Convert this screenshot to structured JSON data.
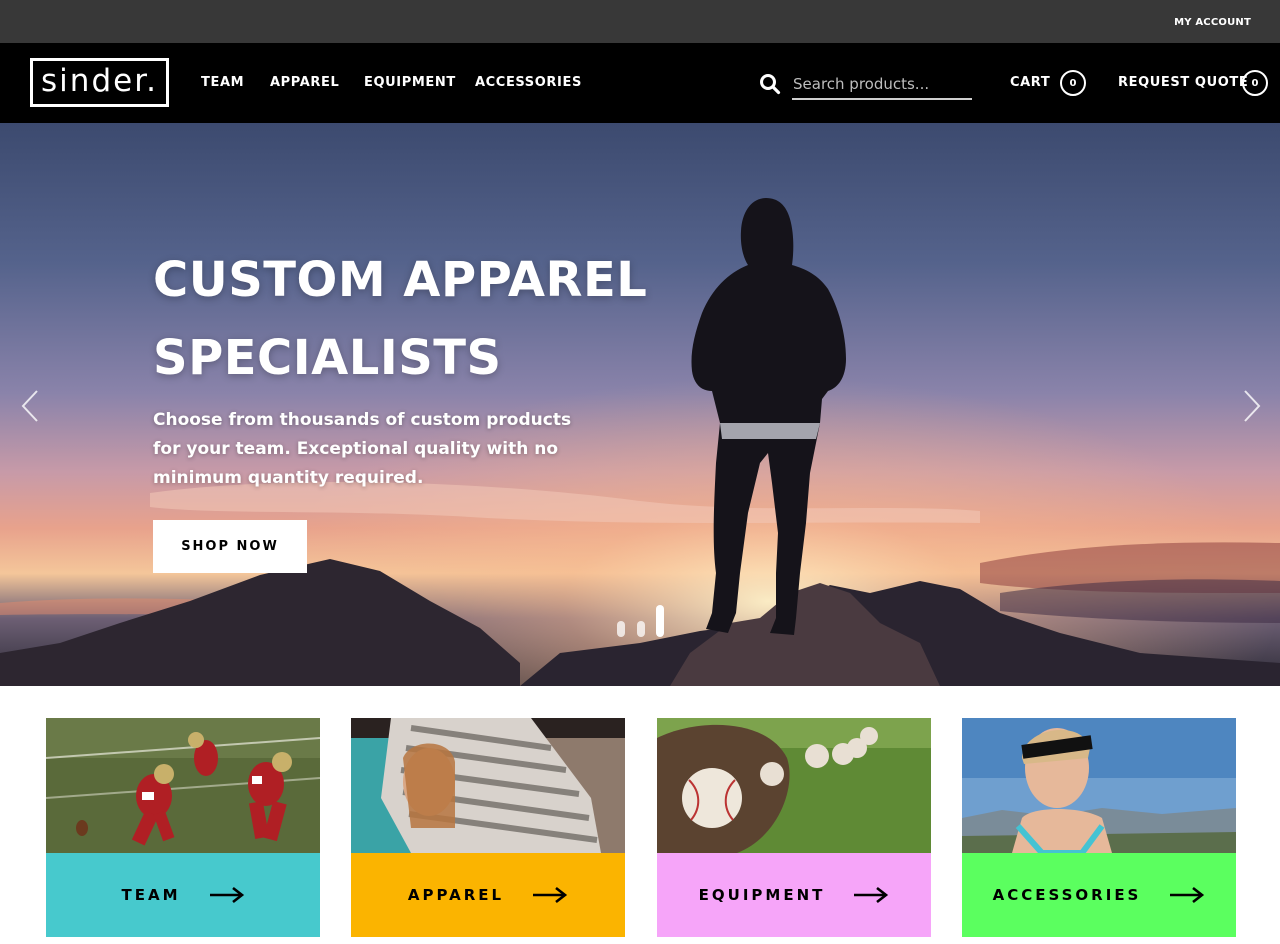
{
  "utility_bar": {
    "my_account": "MY ACCOUNT"
  },
  "header": {
    "logo": "sinder.",
    "nav": [
      {
        "label": "TEAM"
      },
      {
        "label": "APPAREL"
      },
      {
        "label": "EQUIPMENT"
      },
      {
        "label": "ACCESSORIES"
      }
    ],
    "search": {
      "placeholder": "Search products...",
      "value": "",
      "icon": "search-icon"
    },
    "cart": {
      "label": "CART",
      "count": "0"
    },
    "quote": {
      "label": "REQUEST QUOTE",
      "count": "0"
    }
  },
  "hero": {
    "title_line1": "CUSTOM APPAREL",
    "title_line2": "SPECIALISTS",
    "subtitle": "Choose from thousands of custom products for your team. Exceptional quality with no minimum quantity required.",
    "cta": "SHOP NOW",
    "slides": 3,
    "active_slide": 3,
    "prev_icon": "chevron-left-icon",
    "next_icon": "chevron-right-icon"
  },
  "categories": [
    {
      "label": "TEAM",
      "color": "#47c9cd",
      "image": "football-players-photo"
    },
    {
      "label": "APPAREL",
      "color": "#fbb400",
      "image": "striped-hoodie-photo"
    },
    {
      "label": "EQUIPMENT",
      "color": "#f6a5f9",
      "image": "baseball-glove-photo"
    },
    {
      "label": "ACCESSORIES",
      "color": "#5bff5f",
      "image": "headband-athlete-photo"
    }
  ],
  "colors": {
    "utility_bar": "#383838",
    "header": "#000000",
    "text_light": "#ffffff"
  }
}
